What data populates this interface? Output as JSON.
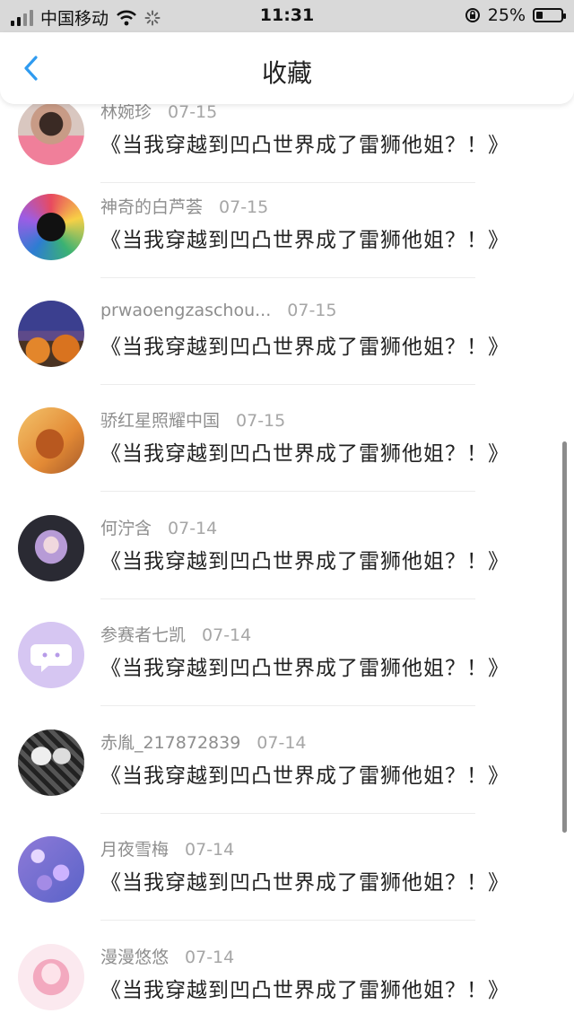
{
  "status_bar": {
    "carrier": "中国移动",
    "time": "11:31",
    "battery_text": "25%",
    "battery_level": 0.25
  },
  "header": {
    "title": "收藏"
  },
  "favorites": [
    {
      "user": "林婉珍",
      "date": "07-15",
      "title": "《当我穿越到凹凸世界成了雷狮他姐？！》",
      "avatar": "avatar-pink-shirt"
    },
    {
      "user": "神奇的白芦荟",
      "date": "07-15",
      "title": "《当我穿越到凹凸世界成了雷狮他姐？！》",
      "avatar": "avatar-colorful-collage"
    },
    {
      "user": "prwaoengzaschou...",
      "date": "07-15",
      "title": "《当我穿越到凹凸世界成了雷狮他姐？！》",
      "avatar": "avatar-pumpkins-night"
    },
    {
      "user": "骄红星照耀中国",
      "date": "07-15",
      "title": "《当我穿越到凹凸世界成了雷狮他姐？！》",
      "avatar": "avatar-squirrel"
    },
    {
      "user": "何泞含",
      "date": "07-14",
      "title": "《当我穿越到凹凸世界成了雷狮他姐？！》",
      "avatar": "avatar-anime-girl"
    },
    {
      "user": "参赛者七凯",
      "date": "07-14",
      "title": "《当我穿越到凹凸世界成了雷狮他姐？！》",
      "avatar": "avatar-default-chat"
    },
    {
      "user": "赤胤_217872839",
      "date": "07-14",
      "title": "《当我穿越到凹凸世界成了雷狮他姐？！》",
      "avatar": "avatar-bw-couple"
    },
    {
      "user": "月夜雪梅",
      "date": "07-14",
      "title": "《当我穿越到凹凸世界成了雷狮他姐？！》",
      "avatar": "avatar-purple-blossoms"
    },
    {
      "user": "漫漫悠悠",
      "date": "07-14",
      "title": "《当我穿越到凹凸世界成了雷狮他姐？！》",
      "avatar": "avatar-pink-anime"
    }
  ]
}
